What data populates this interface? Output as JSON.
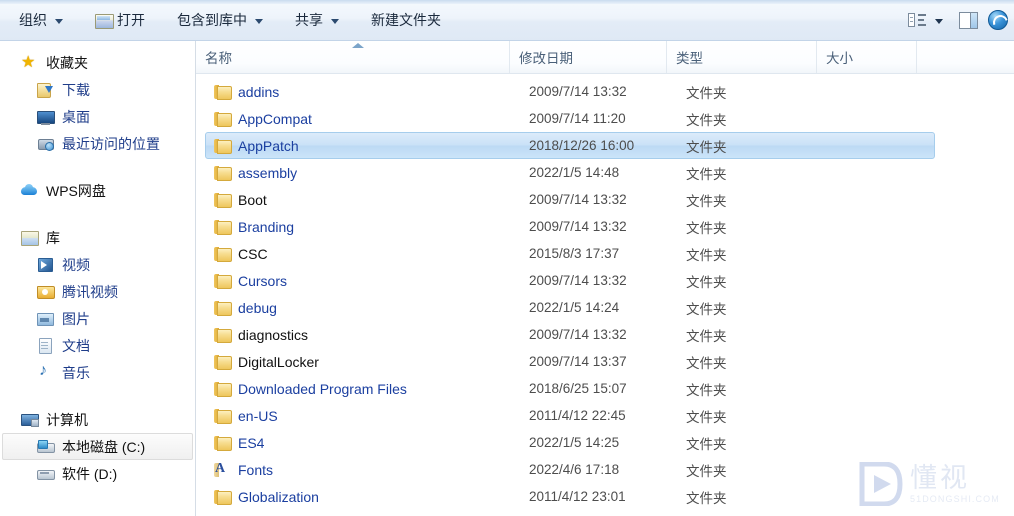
{
  "toolbar": {
    "organize": "组织",
    "open": "打开",
    "include_in_library": "包含到库中",
    "share": "共享",
    "new_folder": "新建文件夹",
    "icons": {
      "open_folder": "open-folder-icon",
      "view_mode": "view-mode-icon",
      "view_dropdown": "chevron-down-icon",
      "preview_pane": "preview-pane-icon",
      "help": "help-icon"
    }
  },
  "sidebar": {
    "groups": [
      {
        "header": {
          "label": "收藏夹",
          "icon": "star-icon"
        },
        "items": [
          {
            "label": "下载",
            "icon": "download-icon"
          },
          {
            "label": "桌面",
            "icon": "desktop-icon"
          },
          {
            "label": "最近访问的位置",
            "icon": "recent-places-icon"
          }
        ]
      },
      {
        "header": {
          "label": "WPS网盘",
          "icon": "cloud-icon"
        },
        "items": []
      },
      {
        "header": {
          "label": "库",
          "icon": "library-icon"
        },
        "items": [
          {
            "label": "视频",
            "icon": "video-icon"
          },
          {
            "label": "腾讯视频",
            "icon": "tencent-video-icon"
          },
          {
            "label": "图片",
            "icon": "pictures-icon"
          },
          {
            "label": "文档",
            "icon": "documents-icon"
          },
          {
            "label": "音乐",
            "icon": "music-icon"
          }
        ]
      },
      {
        "header": {
          "label": "计算机",
          "icon": "computer-icon"
        },
        "items": [
          {
            "label": "本地磁盘 (C:)",
            "icon": "hdd-system-icon",
            "selected": true
          },
          {
            "label": "软件 (D:)",
            "icon": "hdd-icon",
            "selected": false
          }
        ]
      }
    ]
  },
  "file_list": {
    "columns": [
      {
        "key": "name",
        "label": "名称",
        "sorted": "asc"
      },
      {
        "key": "date",
        "label": "修改日期"
      },
      {
        "key": "type",
        "label": "类型"
      },
      {
        "key": "size",
        "label": "大小"
      }
    ],
    "rows": [
      {
        "name": "addins",
        "date": "2009/7/14 13:32",
        "type": "文件夹",
        "size": "",
        "icon": "folder-icon",
        "color": "blue",
        "selected": false
      },
      {
        "name": "AppCompat",
        "date": "2009/7/14 11:20",
        "type": "文件夹",
        "size": "",
        "icon": "folder-icon",
        "color": "blue",
        "selected": false
      },
      {
        "name": "AppPatch",
        "date": "2018/12/26 16:00",
        "type": "文件夹",
        "size": "",
        "icon": "folder-icon",
        "color": "blue",
        "selected": true
      },
      {
        "name": "assembly",
        "date": "2022/1/5 14:48",
        "type": "文件夹",
        "size": "",
        "icon": "folder-icon",
        "color": "blue",
        "selected": false
      },
      {
        "name": "Boot",
        "date": "2009/7/14 13:32",
        "type": "文件夹",
        "size": "",
        "icon": "folder-icon",
        "color": "black",
        "selected": false
      },
      {
        "name": "Branding",
        "date": "2009/7/14 13:32",
        "type": "文件夹",
        "size": "",
        "icon": "folder-icon",
        "color": "blue",
        "selected": false
      },
      {
        "name": "CSC",
        "date": "2015/8/3 17:37",
        "type": "文件夹",
        "size": "",
        "icon": "folder-icon",
        "color": "black",
        "selected": false
      },
      {
        "name": "Cursors",
        "date": "2009/7/14 13:32",
        "type": "文件夹",
        "size": "",
        "icon": "folder-icon",
        "color": "blue",
        "selected": false
      },
      {
        "name": "debug",
        "date": "2022/1/5 14:24",
        "type": "文件夹",
        "size": "",
        "icon": "folder-icon",
        "color": "blue",
        "selected": false
      },
      {
        "name": "diagnostics",
        "date": "2009/7/14 13:32",
        "type": "文件夹",
        "size": "",
        "icon": "folder-icon",
        "color": "black",
        "selected": false
      },
      {
        "name": "DigitalLocker",
        "date": "2009/7/14 13:37",
        "type": "文件夹",
        "size": "",
        "icon": "folder-icon",
        "color": "black",
        "selected": false
      },
      {
        "name": "Downloaded Program Files",
        "date": "2018/6/25 15:07",
        "type": "文件夹",
        "size": "",
        "icon": "folder-icon",
        "color": "blue",
        "selected": false
      },
      {
        "name": "en-US",
        "date": "2011/4/12 22:45",
        "type": "文件夹",
        "size": "",
        "icon": "folder-icon",
        "color": "blue",
        "selected": false
      },
      {
        "name": "ES4",
        "date": "2022/1/5 14:25",
        "type": "文件夹",
        "size": "",
        "icon": "folder-icon",
        "color": "blue",
        "selected": false
      },
      {
        "name": "Fonts",
        "date": "2022/4/6 17:18",
        "type": "文件夹",
        "size": "",
        "icon": "fonts-folder-icon",
        "color": "blue",
        "selected": false
      },
      {
        "name": "Globalization",
        "date": "2011/4/12 23:01",
        "type": "文件夹",
        "size": "",
        "icon": "folder-icon",
        "color": "blue",
        "selected": false
      }
    ]
  },
  "watermark": {
    "cn": "懂视",
    "en": "51DONGSHI.COM"
  },
  "colors": {
    "selection": "#c9e1f7",
    "link_text": "#1b3fa0",
    "toolbar_bg": "#e3ecf7",
    "folder_gold": "#eec65c"
  }
}
